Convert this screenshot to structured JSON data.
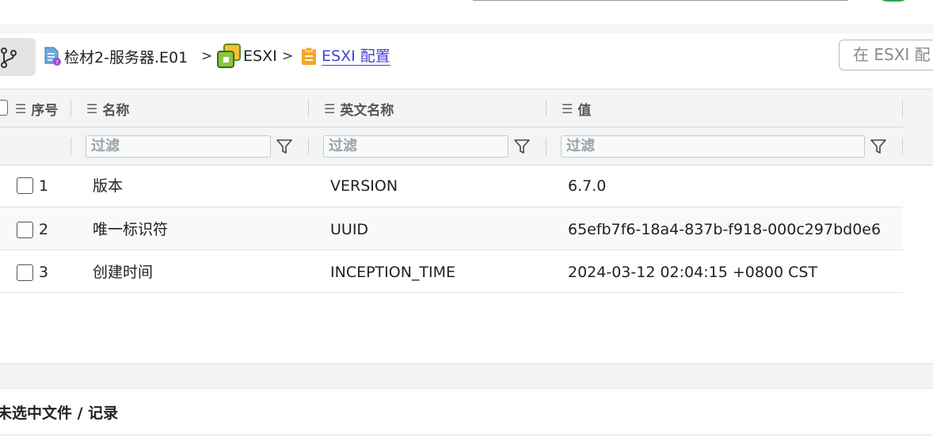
{
  "breadcrumb": {
    "items": [
      {
        "label": "检材2-服务器.E01",
        "icon": "disk-image-icon"
      },
      {
        "label": "ESXI",
        "icon": "vsphere-icon"
      },
      {
        "label": "ESXI 配置",
        "icon": "config-file-icon"
      }
    ],
    "separator": ">"
  },
  "search": {
    "placeholder": "在 ESXI 配"
  },
  "table": {
    "columns": [
      {
        "label": "序号"
      },
      {
        "label": "名称"
      },
      {
        "label": "英文名称"
      },
      {
        "label": "值"
      }
    ],
    "filter_placeholder": "过滤",
    "rows": [
      {
        "index": "1",
        "name": "版本",
        "en_name": "VERSION",
        "value": "6.7.0"
      },
      {
        "index": "2",
        "name": "唯一标识符",
        "en_name": "UUID",
        "value": "65efb7f6-18a4-837b-f918-000c297bd0e6"
      },
      {
        "index": "3",
        "name": "创建时间",
        "en_name": "INCEPTION_TIME",
        "value": "2024-03-12 02:04:15 +0800 CST"
      }
    ]
  },
  "detail": {
    "title": "未选中文件 / 记录"
  },
  "colors": {
    "link": "#4a3fd4",
    "header_bg": "#f3f4f5",
    "accent_green": "#2fa84f",
    "icon_orange": "#f5a623"
  }
}
